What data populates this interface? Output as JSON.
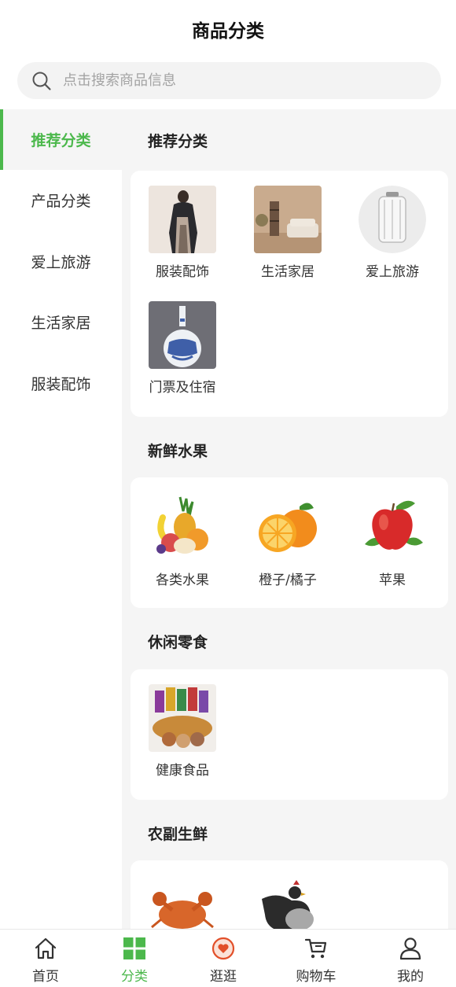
{
  "header": {
    "title": "商品分类"
  },
  "search": {
    "placeholder": "点击搜索商品信息"
  },
  "sidebar": {
    "items": [
      {
        "label": "推荐分类",
        "active": true
      },
      {
        "label": "产品分类",
        "active": false
      },
      {
        "label": "爱上旅游",
        "active": false
      },
      {
        "label": "生活家居",
        "active": false
      },
      {
        "label": "服装配饰",
        "active": false
      }
    ]
  },
  "sections": [
    {
      "title": "推荐分类",
      "items": [
        {
          "label": "服装配饰",
          "icon": "clothing-image"
        },
        {
          "label": "生活家居",
          "icon": "home-living-image"
        },
        {
          "label": "爱上旅游",
          "icon": "suitcase-image"
        },
        {
          "label": "门票及住宿",
          "icon": "vase-image"
        }
      ]
    },
    {
      "title": "新鲜水果",
      "items": [
        {
          "label": "各类水果",
          "icon": "fruit-basket-image"
        },
        {
          "label": "橙子/橘子",
          "icon": "orange-image"
        },
        {
          "label": "苹果",
          "icon": "apple-image"
        }
      ]
    },
    {
      "title": "休闲零食",
      "items": [
        {
          "label": "健康食品",
          "icon": "snacks-image"
        }
      ]
    },
    {
      "title": "农副生鲜",
      "items": [
        {
          "label": "",
          "icon": "crab-image"
        },
        {
          "label": "",
          "icon": "chicken-image"
        }
      ]
    }
  ],
  "tabbar": {
    "items": [
      {
        "label": "首页",
        "icon": "home-icon",
        "active": false
      },
      {
        "label": "分类",
        "icon": "category-icon",
        "active": true
      },
      {
        "label": "逛逛",
        "icon": "heart-chat-icon",
        "active": false
      },
      {
        "label": "购物车",
        "icon": "cart-icon",
        "active": false
      },
      {
        "label": "我的",
        "icon": "user-icon",
        "active": false
      }
    ]
  },
  "colors": {
    "accent": "#4cb84c",
    "background": "#f5f5f5",
    "card": "#ffffff"
  }
}
